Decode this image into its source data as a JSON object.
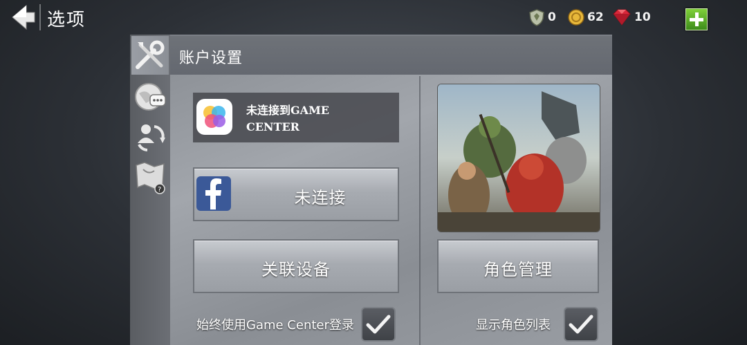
{
  "header": {
    "title": "选项",
    "back_icon": "back-arrow-icon",
    "currencies": [
      {
        "name": "shield",
        "icon": "shield-icon",
        "value": "0"
      },
      {
        "name": "gold",
        "icon": "gold-coin-icon",
        "value": "62"
      },
      {
        "name": "gem",
        "icon": "ruby-gem-icon",
        "value": "10"
      }
    ],
    "add_icon": "plus-icon"
  },
  "tabs": [
    {
      "icon": "tools-icon",
      "active": true
    },
    {
      "icon": "globe-chat-icon",
      "active": false
    },
    {
      "icon": "account-swap-icon",
      "active": false
    },
    {
      "icon": "map-help-icon",
      "active": false
    }
  ],
  "panel": {
    "title": "账户设置"
  },
  "game_center": {
    "status": "未连接到GAME CENTER"
  },
  "facebook": {
    "label": "未连接",
    "icon": "facebook-icon"
  },
  "link_device": {
    "label": "关联设备"
  },
  "character_management": {
    "label": "角色管理"
  },
  "options": {
    "always_game_center": {
      "label": "始终使用Game Center登录",
      "checked": true
    },
    "show_character_list": {
      "label": "显示角色列表",
      "checked": true
    }
  },
  "colors": {
    "accent_green": "#5aa82a",
    "facebook_blue": "#3b5998",
    "gem_red": "#d8283a",
    "gold": "#e8b83a"
  }
}
